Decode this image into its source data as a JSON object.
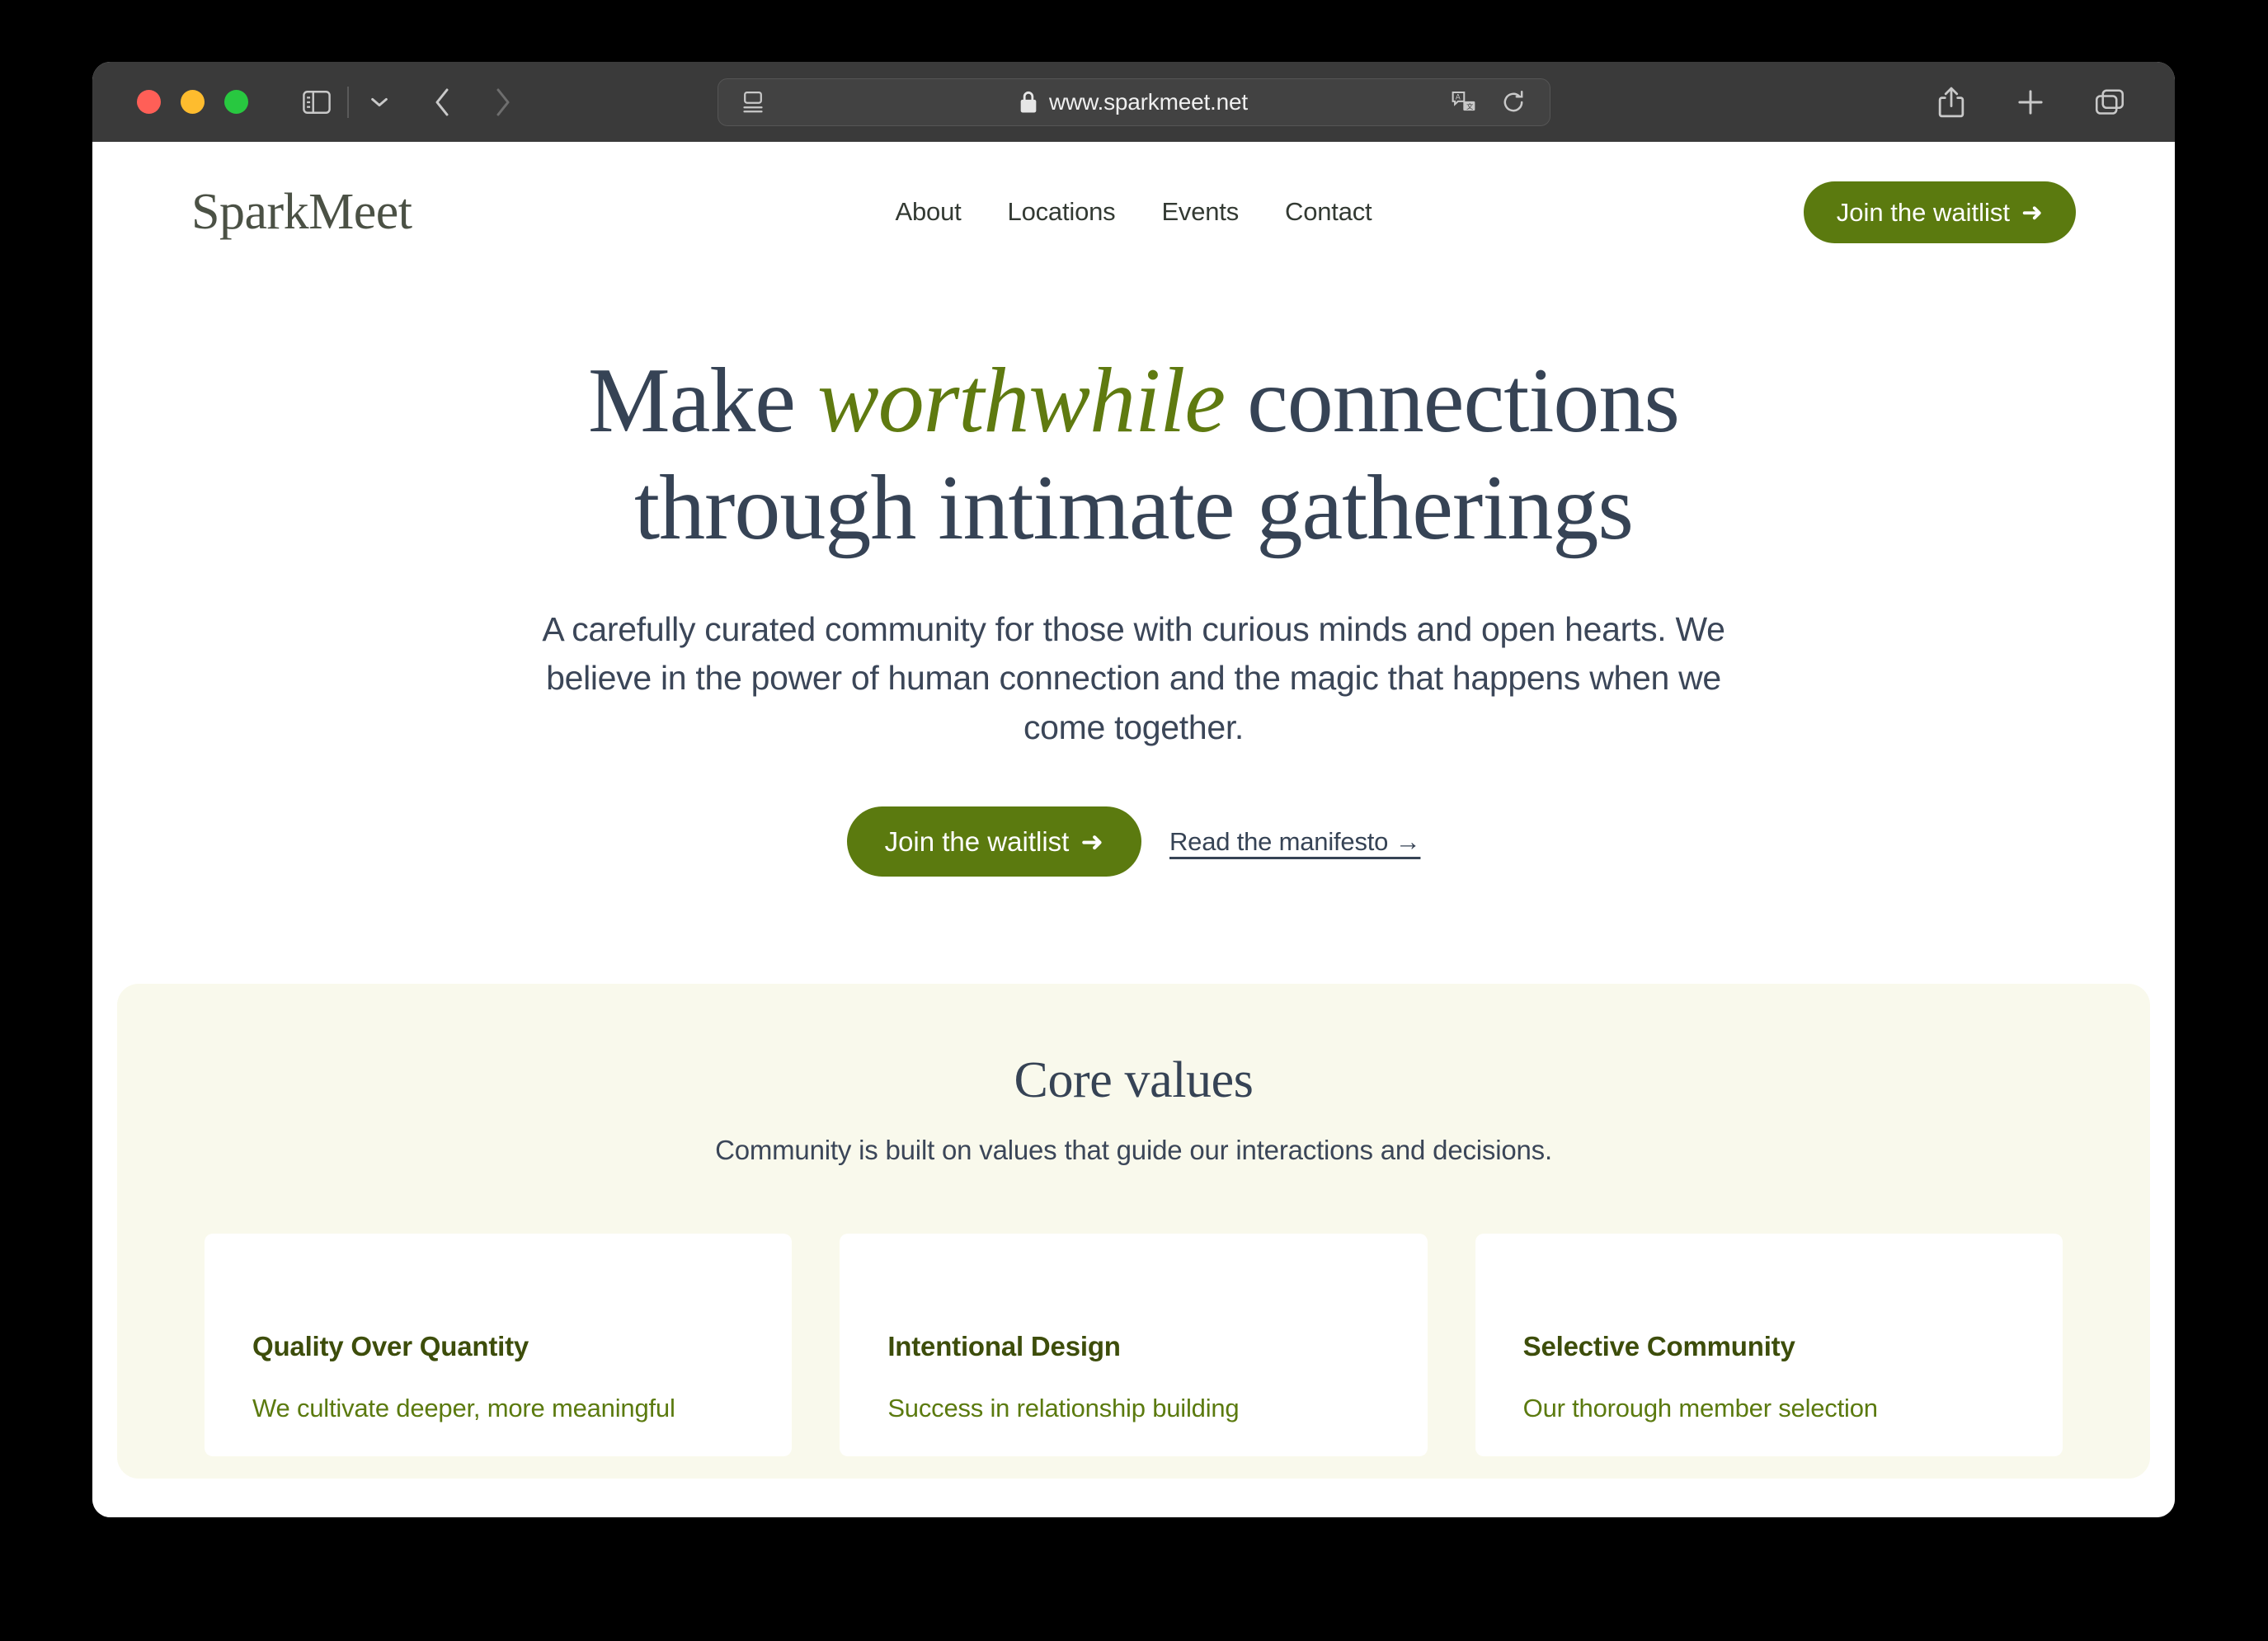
{
  "browser": {
    "url": "www.sparkmeet.net",
    "lock_icon": "lock-icon",
    "reader_icon": "reader-view-icon",
    "translate_icon": "translate-icon",
    "reload_icon": "reload-icon",
    "sidebar_icon": "sidebar-toggle-icon",
    "chevron_icon": "chevron-down-icon",
    "back_icon": "back-arrow-icon",
    "forward_icon": "forward-arrow-icon",
    "share_icon": "share-icon",
    "new_tab_icon": "plus-icon",
    "tab_overview_icon": "tab-overview-icon"
  },
  "site": {
    "logo": "SparkMeet",
    "nav": [
      {
        "label": "About"
      },
      {
        "label": "Locations"
      },
      {
        "label": "Events"
      },
      {
        "label": "Contact"
      }
    ],
    "header_cta": "Join the waitlist",
    "cta_arrow": "➜"
  },
  "hero": {
    "headline_part1": "Make ",
    "headline_emphasis": "worthwhile",
    "headline_part2": " connections",
    "headline_line2": "through intimate gatherings",
    "subtitle": "A carefully curated community for those with curious minds and open hearts. We believe in the power of human connection and the magic that happens when we come together.",
    "primary_cta": "Join the waitlist",
    "secondary_cta": "Read the manifesto →"
  },
  "values": {
    "title": "Core values",
    "subtitle": "Community is built on values that guide our interactions and decisions.",
    "cards": [
      {
        "title": "Quality Over Quantity",
        "body": "We cultivate deeper, more meaningful"
      },
      {
        "title": "Intentional Design",
        "body": "Success in relationship building"
      },
      {
        "title": "Selective Community",
        "body": "Our thorough member selection"
      }
    ]
  },
  "colors": {
    "accent_green": "#5b7a0f",
    "navy": "#364355",
    "cream": "#f9f9ec",
    "logo_olive": "#4b5145",
    "card_heading": "#3d4d0b"
  }
}
